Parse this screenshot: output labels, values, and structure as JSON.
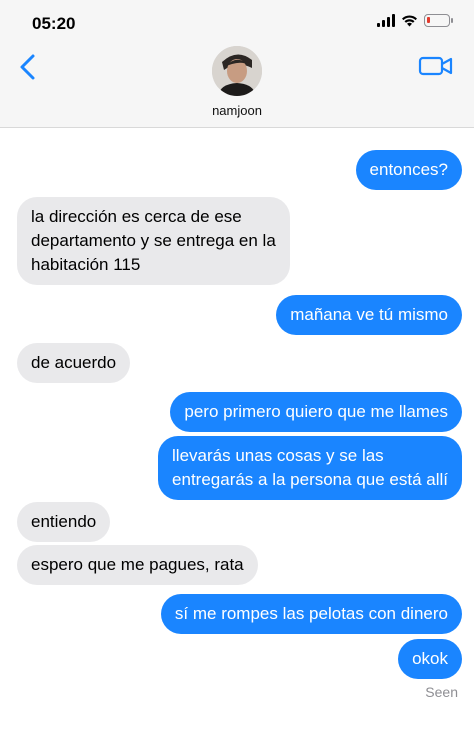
{
  "status_bar": {
    "time": "05:20",
    "battery_level": 0.15,
    "colors": {
      "battery_low": "#e23b2e"
    }
  },
  "header": {
    "contact_name": "namjoon",
    "back_icon": "chevron-left-icon",
    "video_icon": "video-camera-icon",
    "accent_color": "#1a85ff"
  },
  "messages": [
    {
      "from": "me",
      "text": "entonces?"
    },
    {
      "from": "them",
      "text": "la dirección es cerca de ese\ndepartamento y se entrega en la\nhabitación 115"
    },
    {
      "from": "me",
      "text": "mañana ve tú mismo"
    },
    {
      "from": "them",
      "text": "de acuerdo"
    },
    {
      "from": "me",
      "text": "pero primero quiero que me llames"
    },
    {
      "from": "me",
      "text": "llevarás unas cosas y se las\nentregarás a la persona que está allí"
    },
    {
      "from": "them",
      "text": "entiendo"
    },
    {
      "from": "them",
      "text": "espero que me pagues, rata"
    },
    {
      "from": "me",
      "text": "sí me rompes las pelotas con dinero"
    },
    {
      "from": "me",
      "text": "okok"
    }
  ],
  "read_receipt": "Seen"
}
